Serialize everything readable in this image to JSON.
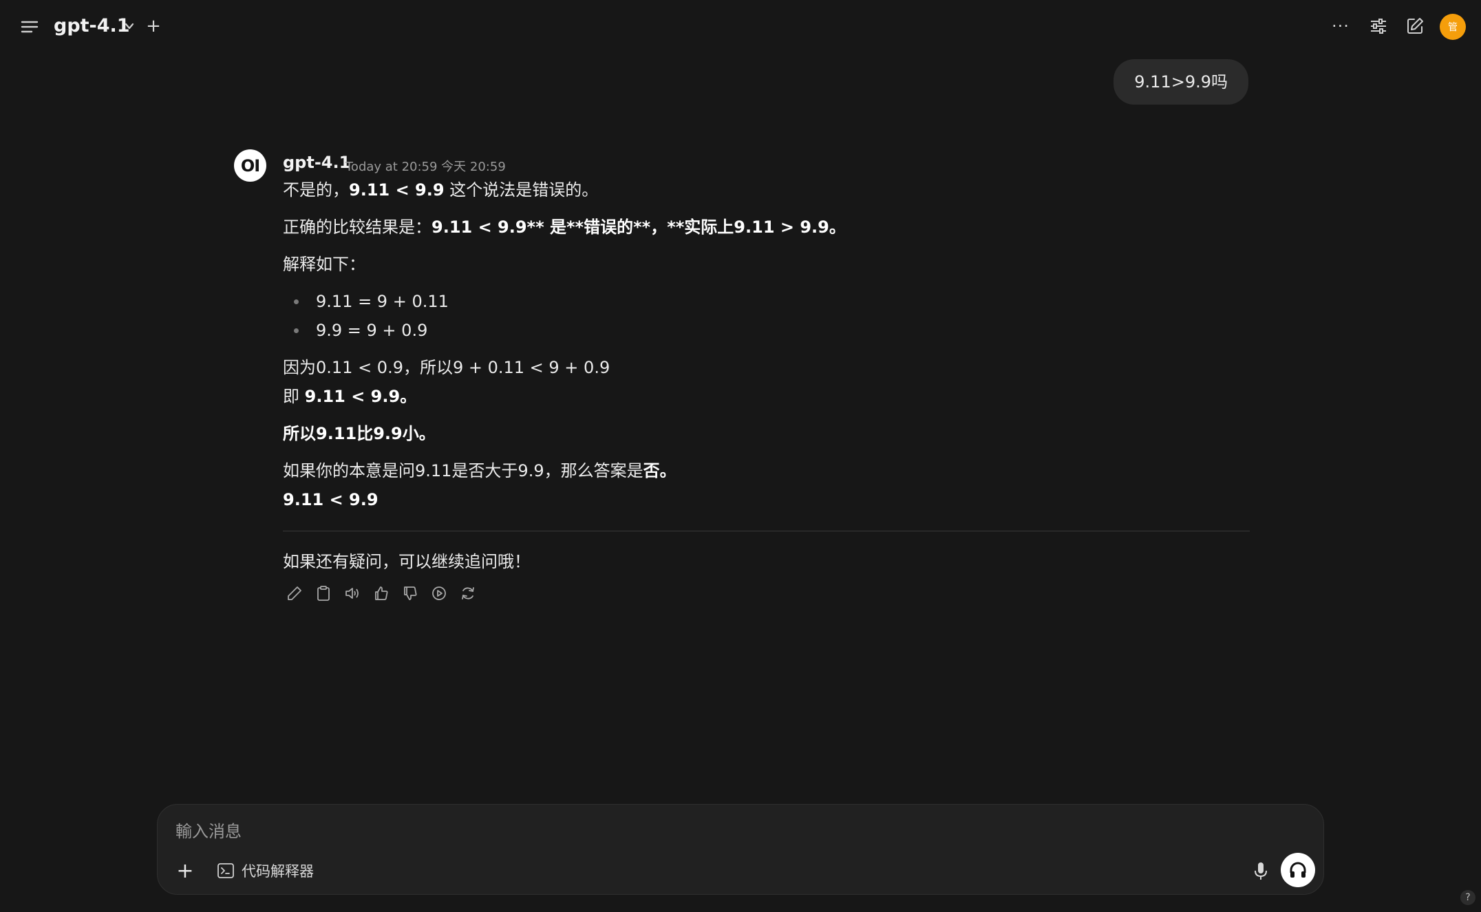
{
  "header": {
    "model_name": "gpt-4.1",
    "plus_label": "+",
    "dots_label": "···",
    "avatar_text": "管"
  },
  "user_message": "9.11>9.9吗",
  "assistant": {
    "avatar_text": "OI",
    "name": "gpt-4.1",
    "timestamp": "Today at 20:59  今天 20:59",
    "p1_a": "不是的，",
    "p1_b": "9.11 < 9.9",
    "p1_c": " 这个说法是错误的。",
    "p2_a": "正确的比较结果是：",
    "p2_b": "9.11 < 9.9** 是**错误的**，**实际上9.11 > 9.9。",
    "p3": "解释如下：",
    "bullet1": "9.11 = 9 + 0.11",
    "bullet2": "9.9 = 9 + 0.9",
    "p4": "因为0.11 < 0.9，所以9 + 0.11 < 9 + 0.9",
    "p5_a": "即 ",
    "p5_b": "9.11 < 9.9。",
    "p6": "所以9.11比9.9小。",
    "p7_a": "如果你的本意是问9.11是否大于9.9，那么答案是",
    "p7_b": "否。",
    "p8": "9.11 < 9.9",
    "p9": "如果还有疑问，可以继续追问哦！"
  },
  "composer": {
    "placeholder": "輸入消息",
    "plus_label": "+",
    "tool_label": "代码解释器"
  },
  "help_label": "?"
}
